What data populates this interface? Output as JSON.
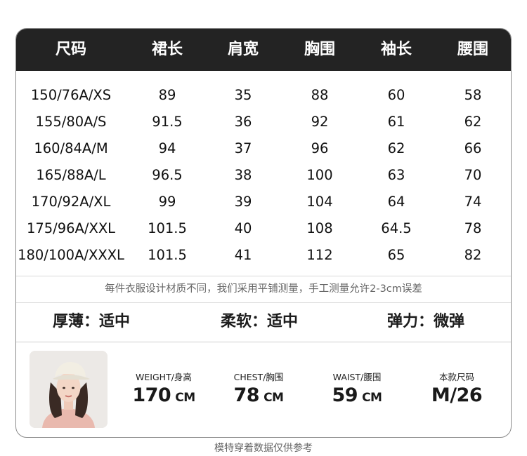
{
  "table": {
    "headers": [
      "尺码",
      "裙长",
      "肩宽",
      "胸围",
      "袖长",
      "腰围"
    ],
    "rows": [
      [
        "150/76A/XS",
        "89",
        "35",
        "88",
        "60",
        "58"
      ],
      [
        "155/80A/S",
        "91.5",
        "36",
        "92",
        "61",
        "62"
      ],
      [
        "160/84A/M",
        "94",
        "37",
        "96",
        "62",
        "66"
      ],
      [
        "165/88A/L",
        "96.5",
        "38",
        "100",
        "63",
        "70"
      ],
      [
        "170/92A/XL",
        "99",
        "39",
        "104",
        "64",
        "74"
      ],
      [
        "175/96A/XXL",
        "101.5",
        "40",
        "108",
        "64.5",
        "78"
      ],
      [
        "180/100A/XXXL",
        "101.5",
        "41",
        "112",
        "65",
        "82"
      ]
    ]
  },
  "note": "每件衣服设计材质不同，我们采用平铺测量，手工测量允许2-3cm误差",
  "attributes": [
    "厚薄：适中",
    "柔软：适中",
    "弹力：微弹"
  ],
  "model": {
    "stats": [
      {
        "label": "WEIGHT/身高",
        "value": "170",
        "unit": "CM"
      },
      {
        "label": "CHEST/胸围",
        "value": "78",
        "unit": "CM"
      },
      {
        "label": "WAIST/腰围",
        "value": "59",
        "unit": "CM"
      },
      {
        "label": "本款尺码",
        "value": "M/26",
        "unit": ""
      }
    ]
  },
  "footer": "模特穿着数据仅供参考",
  "colors": {
    "header_bg": "#232323",
    "header_text": "#ffffff",
    "border": "#8a8a8a"
  }
}
